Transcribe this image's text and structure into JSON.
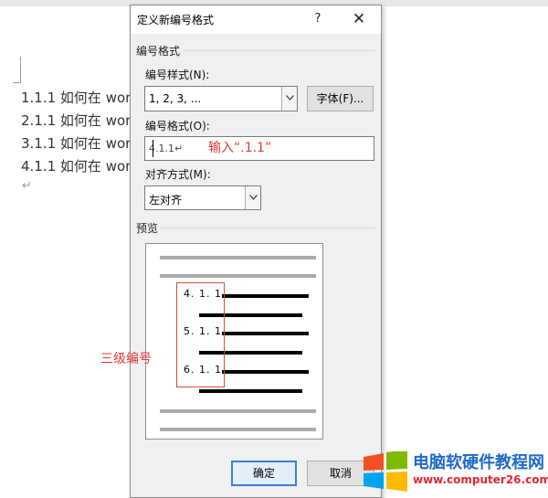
{
  "document": {
    "lines": [
      "1.1.1 如何在 wor",
      "2.1.1 如何在 wor",
      "3.1.1 如何在 wor",
      "4.1.1 如何在 wor"
    ],
    "para_mark": "↵"
  },
  "dialog": {
    "title": "定义新编号格式",
    "help": "?",
    "close": "✕",
    "group_number_format": "编号格式",
    "style_label": "编号样式(N):",
    "style_value": "1, 2, 3, ...",
    "font_button": "字体(F)...",
    "format_label": "编号格式(O):",
    "format_value": "4.1.1↵",
    "align_label": "对齐方式(M):",
    "align_value": "左对齐",
    "group_preview": "预览",
    "ok_button": "确定",
    "cancel_button": "取消"
  },
  "preview": {
    "numbers": [
      "4. 1. 1",
      "5. 1. 1",
      "6. 1. 1"
    ]
  },
  "annotations": {
    "input_hint": "输入“.1.1”",
    "level_hint": "三级编号"
  },
  "watermark": {
    "title": "电脑软硬件教程网",
    "url": "www.computer26.com"
  },
  "colors": {
    "annotation": "#e03a3a",
    "watermark_blue": "#1f69c8",
    "watermark_red": "#e0282e"
  }
}
